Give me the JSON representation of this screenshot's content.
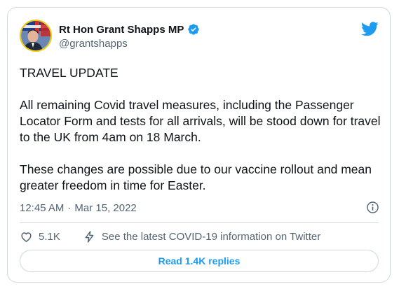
{
  "author": {
    "display_name": "Rt Hon Grant Shapps MP",
    "handle": "@grantshapps",
    "verified": true
  },
  "tweet": {
    "paragraphs": [
      "TRAVEL UPDATE",
      "All remaining Covid travel measures, including the Passenger Locator Form and tests for all arrivals, will be stood down for travel to the UK from 4am on 18 March.",
      "These changes are possible due to our vaccine rollout and mean greater freedom in time for Easter."
    ],
    "time": "12:45 AM",
    "separator": "·",
    "date": "Mar 15, 2022"
  },
  "actions": {
    "like_count": "5.1K",
    "covid_info_label": "See the latest COVID-19 information on Twitter"
  },
  "replies_button_label": "Read 1.4K replies",
  "icons": {
    "brand": "twitter-bird-icon",
    "verified": "verified-badge-icon",
    "info": "info-icon",
    "like": "heart-icon",
    "covid": "lightning-icon"
  },
  "colors": {
    "twitter_blue": "#1d9bf0",
    "text_primary": "#0f1419",
    "text_secondary": "#536471",
    "border": "#cfd9de",
    "avatar_ring": "#f2c70a"
  }
}
